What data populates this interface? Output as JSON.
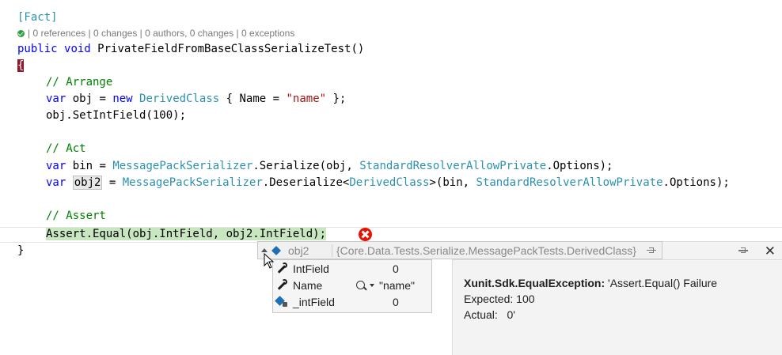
{
  "code": {
    "attribute": "[Fact]",
    "codelens": "| 0 references | 0 changes | 0 authors, 0 changes | 0 exceptions",
    "kw_public": "public",
    "kw_void": "void",
    "method_name": "PrivateFieldFromBaseClassSerializeTest()",
    "open_brace": "{",
    "comment_arrange": "// Arrange",
    "comment_act": "// Act",
    "comment_assert": "// Assert",
    "kw_var": "var",
    "kw_new": "new",
    "line_obj_1": " obj = ",
    "type_derived": "DerivedClass",
    "line_obj_2": " { Name = ",
    "str_name": "\"name\"",
    "line_obj_3": " };",
    "line_setint": "obj.SetIntField(100);",
    "line_bin_1": " bin = ",
    "type_mps": "MessagePackSerializer",
    "line_bin_2": ".Serialize(obj, ",
    "type_resolver": "StandardResolverAllowPrivate",
    "line_bin_3": ".Options);",
    "obj2": "obj2",
    "line_obj2_1": " = ",
    "line_obj2_2": ".Deserialize<",
    "line_obj2_3": ">(bin, ",
    "line_obj2_4": ".Options);",
    "line_assert": "Assert.Equal(obj.IntField, obj2.IntField);",
    "close_brace": "}"
  },
  "datatip": {
    "name": "obj2",
    "value": "{Core.Data.Tests.Serialize.MessagePackTests.DerivedClass}",
    "rows": [
      {
        "name": "IntField",
        "value": "0",
        "icon": "wrench-icon"
      },
      {
        "name": "Name",
        "value": "\"name\"",
        "icon": "wrench-icon"
      },
      {
        "name": "_intField",
        "value": "0",
        "icon": "private-field-icon"
      }
    ]
  },
  "exception": {
    "type": "Xunit.Sdk.EqualException:",
    "message": " 'Assert.Equal() Failure",
    "expected": "Expected: 100",
    "actual": "Actual:   0'"
  },
  "colors": {
    "keyword": "#0000ff",
    "type": "#2b91af",
    "string": "#a31515",
    "comment": "#008000",
    "error": "#e51400"
  }
}
